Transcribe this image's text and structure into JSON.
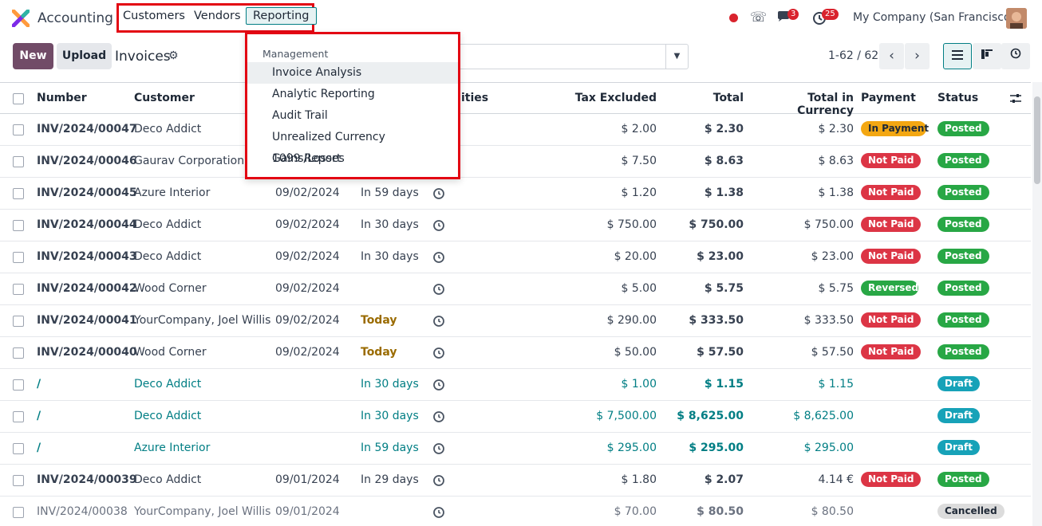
{
  "app": {
    "name": "Accounting"
  },
  "nav": {
    "customers": "Customers",
    "vendors": "Vendors",
    "reporting": "Reporting"
  },
  "systray": {
    "chat_count": "3",
    "activity_count": "25",
    "company": "My Company (San Francisco)"
  },
  "control": {
    "new_label": "New",
    "upload_label": "Upload",
    "title": "Invoices",
    "pager": "1-62 / 62"
  },
  "dropdown": {
    "header": "Management",
    "items": [
      "Invoice Analysis",
      "Analytic Reporting",
      "Audit Trail",
      "Unrealized Currency Gains/Losses",
      "1099 Report"
    ]
  },
  "table": {
    "headers": {
      "number": "Number",
      "customer": "Customer",
      "activities": "ities",
      "tax_excluded": "Tax Excluded",
      "total": "Total",
      "total_currency": "Total in Currency",
      "payment": "Payment",
      "status": "Status"
    },
    "rows": [
      {
        "number": "INV/2024/00047",
        "customer": "Deco Addict",
        "date": "",
        "due": "",
        "tax": "$ 2.00",
        "total": "$ 2.30",
        "cur": "$ 2.30",
        "payment": "In Payment",
        "status": "Posted"
      },
      {
        "number": "INV/2024/00046",
        "customer": "Gaurav Corporation",
        "date": "",
        "due": "",
        "tax": "$ 7.50",
        "total": "$ 8.63",
        "cur": "$ 8.63",
        "payment": "Not Paid",
        "status": "Posted"
      },
      {
        "number": "INV/2024/00045",
        "customer": "Azure Interior",
        "date": "09/02/2024",
        "due": "In 59 days",
        "tax": "$ 1.20",
        "total": "$ 1.38",
        "cur": "$ 1.38",
        "payment": "Not Paid",
        "status": "Posted"
      },
      {
        "number": "INV/2024/00044",
        "customer": "Deco Addict",
        "date": "09/02/2024",
        "due": "In 30 days",
        "tax": "$ 750.00",
        "total": "$ 750.00",
        "cur": "$ 750.00",
        "payment": "Not Paid",
        "status": "Posted"
      },
      {
        "number": "INV/2024/00043",
        "customer": "Deco Addict",
        "date": "09/02/2024",
        "due": "In 30 days",
        "tax": "$ 20.00",
        "total": "$ 23.00",
        "cur": "$ 23.00",
        "payment": "Not Paid",
        "status": "Posted"
      },
      {
        "number": "INV/2024/00042",
        "customer": "Wood Corner",
        "date": "09/02/2024",
        "due": "",
        "tax": "$ 5.00",
        "total": "$ 5.75",
        "cur": "$ 5.75",
        "payment": "Reversed",
        "status": "Posted"
      },
      {
        "number": "INV/2024/00041",
        "customer": "YourCompany, Joel Willis",
        "date": "09/02/2024",
        "due": "Today",
        "tax": "$ 290.00",
        "total": "$ 333.50",
        "cur": "$ 333.50",
        "payment": "Not Paid",
        "status": "Posted"
      },
      {
        "number": "INV/2024/00040",
        "customer": "Wood Corner",
        "date": "09/02/2024",
        "due": "Today",
        "tax": "$ 50.00",
        "total": "$ 57.50",
        "cur": "$ 57.50",
        "payment": "Not Paid",
        "status": "Posted"
      },
      {
        "number": "/",
        "customer": "Deco Addict",
        "date": "",
        "due": "In 30 days",
        "tax": "$ 1.00",
        "total": "$ 1.15",
        "cur": "$ 1.15",
        "payment": "",
        "status": "Draft"
      },
      {
        "number": "/",
        "customer": "Deco Addict",
        "date": "",
        "due": "In 30 days",
        "tax": "$ 7,500.00",
        "total": "$ 8,625.00",
        "cur": "$ 8,625.00",
        "payment": "",
        "status": "Draft"
      },
      {
        "number": "/",
        "customer": "Azure Interior",
        "date": "",
        "due": "In 59 days",
        "tax": "$ 295.00",
        "total": "$ 295.00",
        "cur": "$ 295.00",
        "payment": "",
        "status": "Draft"
      },
      {
        "number": "INV/2024/00039",
        "customer": "Deco Addict",
        "date": "09/01/2024",
        "due": "In 29 days",
        "tax": "$ 1.80",
        "total": "$ 2.07",
        "cur": "4.14 €",
        "payment": "Not Paid",
        "status": "Posted"
      },
      {
        "number": "INV/2024/00038",
        "customer": "YourCompany, Joel Willis",
        "date": "09/01/2024",
        "due": "",
        "tax": "$ 70.00",
        "total": "$ 80.50",
        "cur": "$ 80.50",
        "payment": "",
        "status": "Cancelled"
      }
    ]
  },
  "colors": {
    "primary": "#714b67",
    "teal": "#017e84",
    "posted": "#28a745",
    "not_paid": "#dc3545",
    "in_payment": "#f3a712",
    "reversed": "#28a745",
    "draft": "#17a2b8",
    "cancelled": "#dcdcdc"
  }
}
